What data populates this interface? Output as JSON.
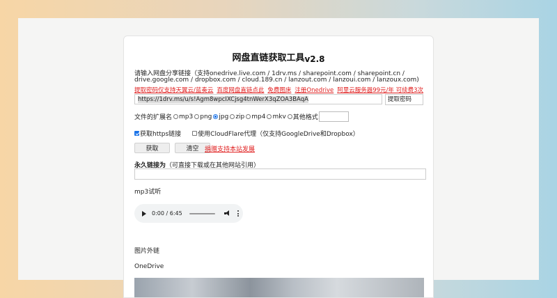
{
  "title": "网盘直链获取工具",
  "version": "v2.8",
  "instructions_line1": "请输入网盘分享链接（支持onedrive.live.com / 1drv.ms / sharepoint.com / sharepoint.cn /",
  "instructions_line2": "drive.google.com / dropbox.com / cloud.189.cn / lanzout.com / lanzoui.com / lanzoux.com)",
  "links": [
    "提取密码仅支持天翼云/蓝奏云",
    "百度网盘直链点此",
    "免费图床",
    "注册Onedrive",
    "阿里云服务器99元/年 可续费3次"
  ],
  "url_input_value": "https://1drv.ms/u/s!Agm8wpcIXCjsg4tnWerX3qZOA3BAqA",
  "password_placeholder": "提取密码",
  "ext_label": "文件的扩展名",
  "ext_options": [
    {
      "label": "mp3",
      "checked": false
    },
    {
      "label": "png",
      "checked": false
    },
    {
      "label": "jpg",
      "checked": true
    },
    {
      "label": "zip",
      "checked": false
    },
    {
      "label": "mp4",
      "checked": false
    },
    {
      "label": "mkv",
      "checked": false
    },
    {
      "label": "其他格式",
      "checked": false
    }
  ],
  "https_label": "获取https链接",
  "https_checked": true,
  "cloudflare_label": "使用CloudFlare代理（仅支持GoogleDrive和Dropbox）",
  "cloudflare_checked": false,
  "get_button": "获取",
  "clear_button": "清空",
  "donate_link": "捐赠支持本站发展",
  "permanent_label": "永久链接为",
  "permanent_note": "（可直接下载或在其他网站引用）",
  "mp3_section": "mp3试听",
  "audio_time": "0:00 / 6:45",
  "image_section": "图片外链",
  "onedrive_label": "OneDrive",
  "colors": {
    "accent": "#1a73e8",
    "link": "#e02020"
  }
}
